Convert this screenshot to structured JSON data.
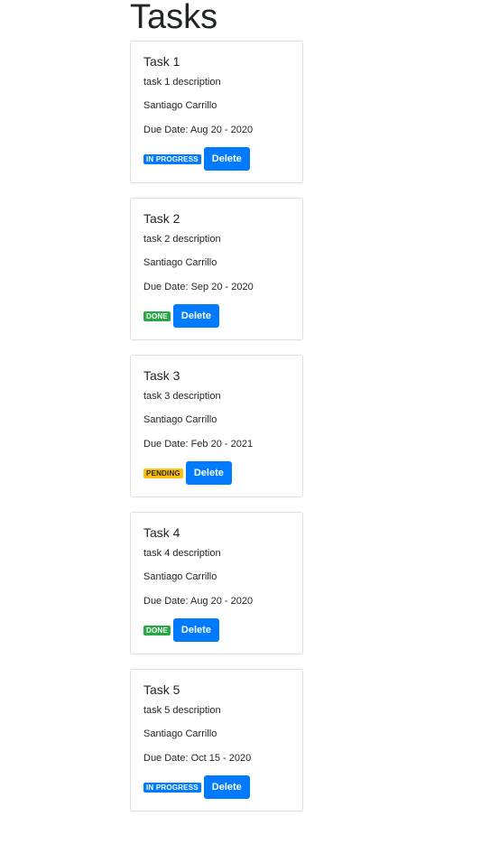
{
  "page": {
    "title": "Tasks"
  },
  "tasks": [
    {
      "title": "Task 1",
      "description": "task 1 description",
      "owner": "Santiago Carrillo",
      "due": "Due Date: Aug 20 - 2020",
      "status": "IN PROGRESS",
      "delete_label": "Delete"
    },
    {
      "title": "Task 2",
      "description": "task 2 description",
      "owner": "Santiago Carrillo",
      "due": "Due Date: Sep 20 - 2020",
      "status": "DONE",
      "delete_label": "Delete"
    },
    {
      "title": "Task 3",
      "description": "task 3 description",
      "owner": "Santiago Carrillo",
      "due": "Due Date: Feb 20 - 2021",
      "status": "PENDING",
      "delete_label": "Delete"
    },
    {
      "title": "Task 4",
      "description": "task 4 description",
      "owner": "Santiago Carrillo",
      "due": "Due Date: Aug 20 - 2020",
      "status": "DONE",
      "delete_label": "Delete"
    },
    {
      "title": "Task 5",
      "description": "task 5 description",
      "owner": "Santiago Carrillo",
      "due": "Due Date: Oct 15 - 2020",
      "status": "IN PROGRESS",
      "delete_label": "Delete"
    }
  ],
  "colors": {
    "primary": "#007bff",
    "success": "#28a745",
    "warning": "#ffc107",
    "text": "#212529"
  }
}
